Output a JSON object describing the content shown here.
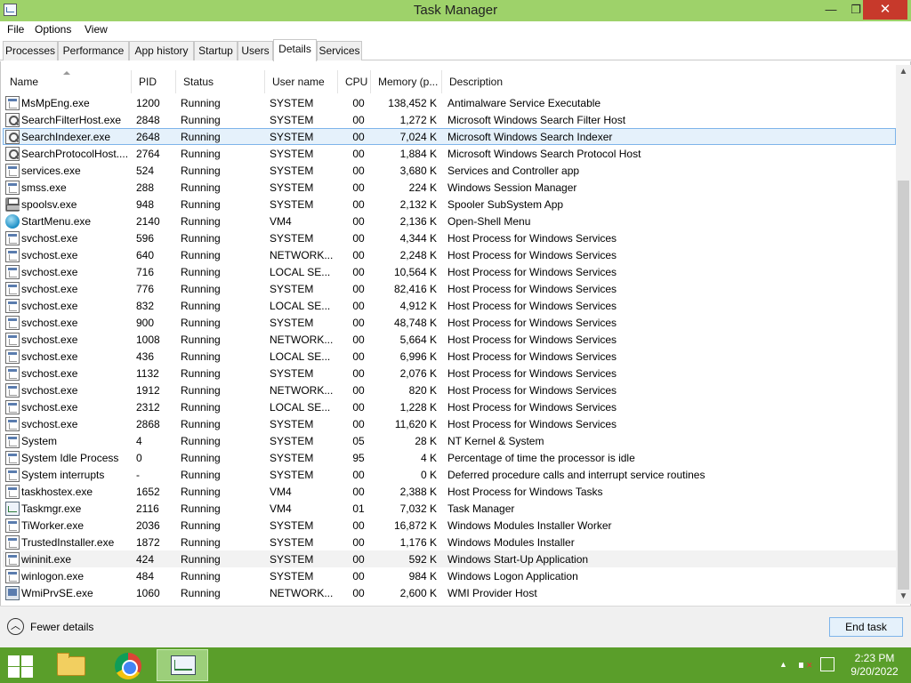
{
  "window": {
    "title": "Task Manager"
  },
  "menu": {
    "file": "File",
    "options": "Options",
    "view": "View"
  },
  "tabs": [
    "Processes",
    "Performance",
    "App history",
    "Startup",
    "Users",
    "Details",
    "Services"
  ],
  "active_tab": "Details",
  "columns": {
    "name": "Name",
    "pid": "PID",
    "status": "Status",
    "user": "User name",
    "cpu": "CPU",
    "memory": "Memory (p...",
    "description": "Description"
  },
  "rows": [
    {
      "icon": "generic",
      "name": "MsMpEng.exe",
      "pid": "1200",
      "status": "Running",
      "user": "SYSTEM",
      "cpu": "00",
      "memory": "138,452 K",
      "description": "Antimalware Service Executable"
    },
    {
      "icon": "search",
      "name": "SearchFilterHost.exe",
      "pid": "2848",
      "status": "Running",
      "user": "SYSTEM",
      "cpu": "00",
      "memory": "1,272 K",
      "description": "Microsoft Windows Search Filter Host"
    },
    {
      "icon": "search",
      "name": "SearchIndexer.exe",
      "pid": "2648",
      "status": "Running",
      "user": "SYSTEM",
      "cpu": "00",
      "memory": "7,024 K",
      "description": "Microsoft Windows Search Indexer"
    },
    {
      "icon": "search",
      "name": "SearchProtocolHost....",
      "pid": "2764",
      "status": "Running",
      "user": "SYSTEM",
      "cpu": "00",
      "memory": "1,884 K",
      "description": "Microsoft Windows Search Protocol Host"
    },
    {
      "icon": "generic",
      "name": "services.exe",
      "pid": "524",
      "status": "Running",
      "user": "SYSTEM",
      "cpu": "00",
      "memory": "3,680 K",
      "description": "Services and Controller app"
    },
    {
      "icon": "generic",
      "name": "smss.exe",
      "pid": "288",
      "status": "Running",
      "user": "SYSTEM",
      "cpu": "00",
      "memory": "224 K",
      "description": "Windows Session Manager"
    },
    {
      "icon": "printer",
      "name": "spoolsv.exe",
      "pid": "948",
      "status": "Running",
      "user": "SYSTEM",
      "cpu": "00",
      "memory": "2,132 K",
      "description": "Spooler SubSystem App"
    },
    {
      "icon": "globe",
      "name": "StartMenu.exe",
      "pid": "2140",
      "status": "Running",
      "user": "VM4",
      "cpu": "00",
      "memory": "2,136 K",
      "description": "Open-Shell Menu"
    },
    {
      "icon": "generic",
      "name": "svchost.exe",
      "pid": "596",
      "status": "Running",
      "user": "SYSTEM",
      "cpu": "00",
      "memory": "4,344 K",
      "description": "Host Process for Windows Services"
    },
    {
      "icon": "generic",
      "name": "svchost.exe",
      "pid": "640",
      "status": "Running",
      "user": "NETWORK...",
      "cpu": "00",
      "memory": "2,248 K",
      "description": "Host Process for Windows Services"
    },
    {
      "icon": "generic",
      "name": "svchost.exe",
      "pid": "716",
      "status": "Running",
      "user": "LOCAL SE...",
      "cpu": "00",
      "memory": "10,564 K",
      "description": "Host Process for Windows Services"
    },
    {
      "icon": "generic",
      "name": "svchost.exe",
      "pid": "776",
      "status": "Running",
      "user": "SYSTEM",
      "cpu": "00",
      "memory": "82,416 K",
      "description": "Host Process for Windows Services"
    },
    {
      "icon": "generic",
      "name": "svchost.exe",
      "pid": "832",
      "status": "Running",
      "user": "LOCAL SE...",
      "cpu": "00",
      "memory": "4,912 K",
      "description": "Host Process for Windows Services"
    },
    {
      "icon": "generic",
      "name": "svchost.exe",
      "pid": "900",
      "status": "Running",
      "user": "SYSTEM",
      "cpu": "00",
      "memory": "48,748 K",
      "description": "Host Process for Windows Services"
    },
    {
      "icon": "generic",
      "name": "svchost.exe",
      "pid": "1008",
      "status": "Running",
      "user": "NETWORK...",
      "cpu": "00",
      "memory": "5,664 K",
      "description": "Host Process for Windows Services"
    },
    {
      "icon": "generic",
      "name": "svchost.exe",
      "pid": "436",
      "status": "Running",
      "user": "LOCAL SE...",
      "cpu": "00",
      "memory": "6,996 K",
      "description": "Host Process for Windows Services"
    },
    {
      "icon": "generic",
      "name": "svchost.exe",
      "pid": "1132",
      "status": "Running",
      "user": "SYSTEM",
      "cpu": "00",
      "memory": "2,076 K",
      "description": "Host Process for Windows Services"
    },
    {
      "icon": "generic",
      "name": "svchost.exe",
      "pid": "1912",
      "status": "Running",
      "user": "NETWORK...",
      "cpu": "00",
      "memory": "820 K",
      "description": "Host Process for Windows Services"
    },
    {
      "icon": "generic",
      "name": "svchost.exe",
      "pid": "2312",
      "status": "Running",
      "user": "LOCAL SE...",
      "cpu": "00",
      "memory": "1,228 K",
      "description": "Host Process for Windows Services"
    },
    {
      "icon": "generic",
      "name": "svchost.exe",
      "pid": "2868",
      "status": "Running",
      "user": "SYSTEM",
      "cpu": "00",
      "memory": "11,620 K",
      "description": "Host Process for Windows Services"
    },
    {
      "icon": "generic",
      "name": "System",
      "pid": "4",
      "status": "Running",
      "user": "SYSTEM",
      "cpu": "05",
      "memory": "28 K",
      "description": "NT Kernel & System"
    },
    {
      "icon": "generic",
      "name": "System Idle Process",
      "pid": "0",
      "status": "Running",
      "user": "SYSTEM",
      "cpu": "95",
      "memory": "4 K",
      "description": "Percentage of time the processor is idle"
    },
    {
      "icon": "generic",
      "name": "System interrupts",
      "pid": "-",
      "status": "Running",
      "user": "SYSTEM",
      "cpu": "00",
      "memory": "0 K",
      "description": "Deferred procedure calls and interrupt service routines"
    },
    {
      "icon": "generic",
      "name": "taskhostex.exe",
      "pid": "1652",
      "status": "Running",
      "user": "VM4",
      "cpu": "00",
      "memory": "2,388 K",
      "description": "Host Process for Windows Tasks"
    },
    {
      "icon": "taskmgr",
      "name": "Taskmgr.exe",
      "pid": "2116",
      "status": "Running",
      "user": "VM4",
      "cpu": "01",
      "memory": "7,032 K",
      "description": "Task Manager"
    },
    {
      "icon": "generic",
      "name": "TiWorker.exe",
      "pid": "2036",
      "status": "Running",
      "user": "SYSTEM",
      "cpu": "00",
      "memory": "16,872 K",
      "description": "Windows Modules Installer Worker"
    },
    {
      "icon": "generic",
      "name": "TrustedInstaller.exe",
      "pid": "1872",
      "status": "Running",
      "user": "SYSTEM",
      "cpu": "00",
      "memory": "1,176 K",
      "description": "Windows Modules Installer"
    },
    {
      "icon": "generic",
      "name": "wininit.exe",
      "pid": "424",
      "status": "Running",
      "user": "SYSTEM",
      "cpu": "00",
      "memory": "592 K",
      "description": "Windows Start-Up Application"
    },
    {
      "icon": "generic",
      "name": "winlogon.exe",
      "pid": "484",
      "status": "Running",
      "user": "SYSTEM",
      "cpu": "00",
      "memory": "984 K",
      "description": "Windows Logon Application"
    },
    {
      "icon": "wmi",
      "name": "WmiPrvSE.exe",
      "pid": "1060",
      "status": "Running",
      "user": "NETWORK...",
      "cpu": "00",
      "memory": "2,600 K",
      "description": "WMI Provider Host"
    }
  ],
  "selected_row_index": 2,
  "hovered_row_index": 27,
  "footer": {
    "fewer_details": "Fewer details",
    "end_task": "End task"
  },
  "taskbar": {
    "time": "2:23 PM",
    "date": "9/20/2022"
  },
  "colors": {
    "titlebar": "#9ed26a",
    "taskbar": "#5a9e2a",
    "selection": "#e5f1fb",
    "close_button": "#c7392b"
  }
}
